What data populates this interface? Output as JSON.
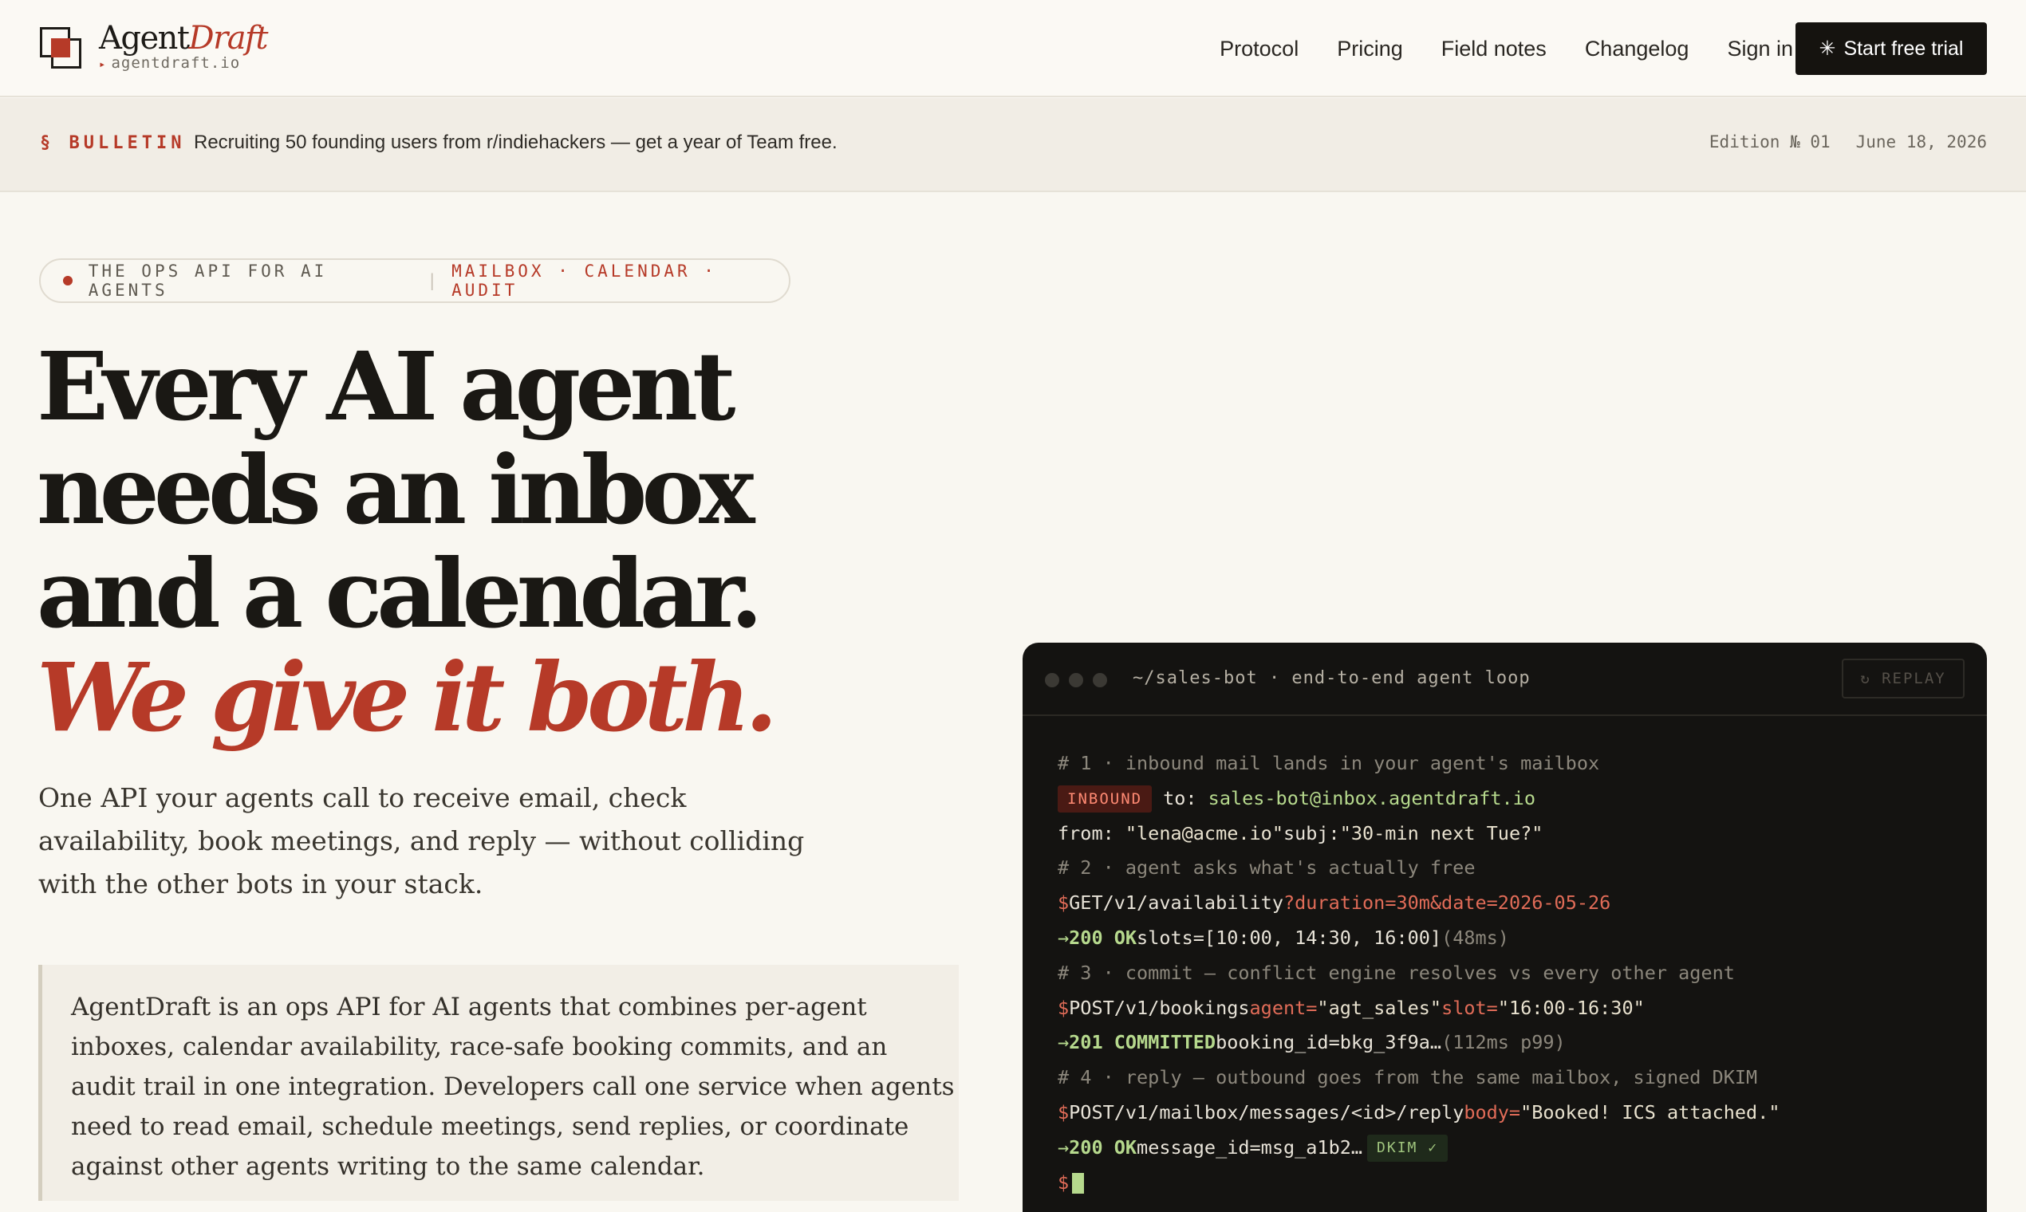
{
  "brand": {
    "name_main": "Agent",
    "name_accent": "Draft",
    "domain": "agentdraft.io"
  },
  "nav": {
    "items": [
      "Protocol",
      "Pricing",
      "Field notes",
      "Changelog",
      "Sign in"
    ],
    "cta": "Start free trial"
  },
  "bulletin": {
    "tag": "§ BULLETIN",
    "message": "Recruiting 50 founding users from r/indiehackers — get a year of Team free.",
    "edition": "Edition № 01",
    "date": "June 18, 2026"
  },
  "pill": {
    "left": "THE OPS API FOR AI AGENTS",
    "right": "MAILBOX · CALENDAR · AUDIT"
  },
  "headline": {
    "line1": "Every AI agent",
    "line2": "needs an inbox",
    "line3": "and a calendar.",
    "accent": "We give it both."
  },
  "lede": "One API your agents call to receive email, check availability, book meetings, and reply — without colliding with the other bots in your stack.",
  "summary": "AgentDraft is an ops API for AI agents that combines per-agent inboxes, calendar availability, race-safe booking commits, and an audit trail in one integration. Developers call one service when agents need to read email, schedule meetings, send replies, or coordinate against other agents writing to the same calendar.",
  "terminal": {
    "title": "~/sales-bot · end-to-end agent loop",
    "replay": "↻ REPLAY",
    "l1": "# 1 · inbound mail lands in your agent's mailbox",
    "l2_badge": "INBOUND",
    "l2_key": "to: ",
    "l2_val": "sales-bot@inbox.agentdraft.io",
    "l3_key": "from: ",
    "l3_val": "\"lena@acme.io\"",
    "l3_key2": "subj:",
    "l3_val2": "\"30-min next Tue?\"",
    "l4": "# 2 · agent asks what's actually free",
    "l5_prompt": "$",
    "l5_cmd": "GET/v1/availability",
    "l5_args": "?duration=30m&date=2026-05-26",
    "l6_arrow": "→",
    "l6_status": "200 OK",
    "l6_body": "slots=[10:00, 14:30, 16:00]",
    "l6_timing": "(48ms)",
    "l7": "# 3 · commit — conflict engine resolves vs every other agent",
    "l8_prompt": "$",
    "l8_cmd": "POST/v1/bookings",
    "l8_k1": "agent=",
    "l8_v1": "\"agt_sales\"",
    "l8_k2": "slot=",
    "l8_v2": "\"16:00-16:30\"",
    "l9_arrow": "→",
    "l9_status": "201 COMMITTED",
    "l9_body": "booking_id=bkg_3f9a…",
    "l9_timing": "(112ms p99)",
    "l10": "# 4 · reply — outbound goes from the same mailbox, signed DKIM",
    "l11_prompt": "$",
    "l11_cmd": "POST/v1/mailbox/messages/<id>/reply",
    "l11_k1": "body=",
    "l11_v1": "\"Booked! ICS attached.\"",
    "l12_arrow": "→",
    "l12_status": "200 OK",
    "l12_body": "message_id=msg_a1b2…",
    "l12_badge": "DKIM ✓",
    "l13_prompt": "$"
  },
  "colors": {
    "accent": "#b63a28",
    "background": "#f9f7f1",
    "terminal_bg": "#141311",
    "terminal_green": "#b6d98d",
    "terminal_red": "#e16c58"
  }
}
